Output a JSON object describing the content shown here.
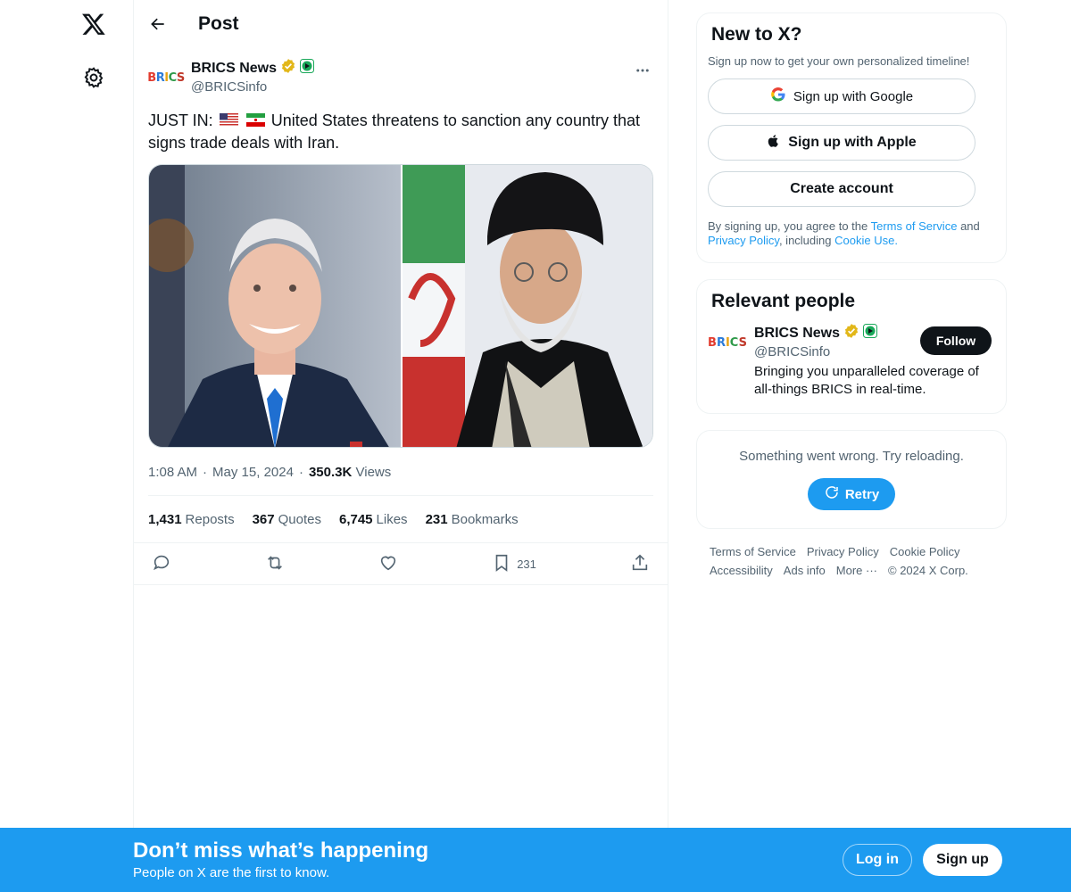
{
  "colors": {
    "accent": "#1d9bf0",
    "text": "#0f1419",
    "muted": "#536471",
    "border": "#eff3f4",
    "verified_gold": "#e2b719",
    "follow_bg": "#0f1419"
  },
  "nav": {
    "logo_icon": "x-logo-icon",
    "settings_icon": "gear-icon"
  },
  "header": {
    "title": "Post",
    "back_icon": "arrow-left-icon"
  },
  "post": {
    "author_name": "BRICS News",
    "handle": "@BRICSinfo",
    "avatar_text": "BRICS",
    "text_prefix": "JUST IN:",
    "text_main": "United States threatens to sanction any country that signs trade deals with Iran.",
    "flags": [
      "us-flag-icon",
      "iran-flag-icon"
    ],
    "time": "1:08 AM",
    "date": "May 15, 2024",
    "views_count": "350.3K",
    "views_label": "Views",
    "stats": [
      {
        "count": "1,431",
        "label": "Reposts"
      },
      {
        "count": "367",
        "label": "Quotes"
      },
      {
        "count": "6,745",
        "label": "Likes"
      },
      {
        "count": "231",
        "label": "Bookmarks"
      }
    ],
    "bookmark_count": "231"
  },
  "signup_card": {
    "title": "New to X?",
    "subtitle": "Sign up now to get your own personalized timeline!",
    "google_label": "Sign up with Google",
    "apple_label": "Sign up with Apple",
    "create_label": "Create account",
    "legal_prefix": "By signing up, you agree to the",
    "terms_link": "Terms of Service",
    "legal_and": "and",
    "privacy_link": "Privacy Policy",
    "legal_including": ", including",
    "cookie_link": "Cookie Use",
    "legal_end": "."
  },
  "relevant": {
    "title": "Relevant people",
    "name": "BRICS News",
    "handle": "@BRICSinfo",
    "follow_label": "Follow",
    "bio": "Bringing you unparalleled coverage of all-things BRICS in real-time."
  },
  "error_card": {
    "message": "Something went wrong. Try reloading.",
    "retry_label": "Retry"
  },
  "footer": {
    "links": [
      "Terms of Service",
      "Privacy Policy",
      "Cookie Policy",
      "Accessibility",
      "Ads info",
      "More ···",
      "© 2024 X Corp."
    ]
  },
  "banner": {
    "title": "Don’t miss what’s happening",
    "subtitle": "People on X are the first to know.",
    "login_label": "Log in",
    "signup_label": "Sign up"
  }
}
